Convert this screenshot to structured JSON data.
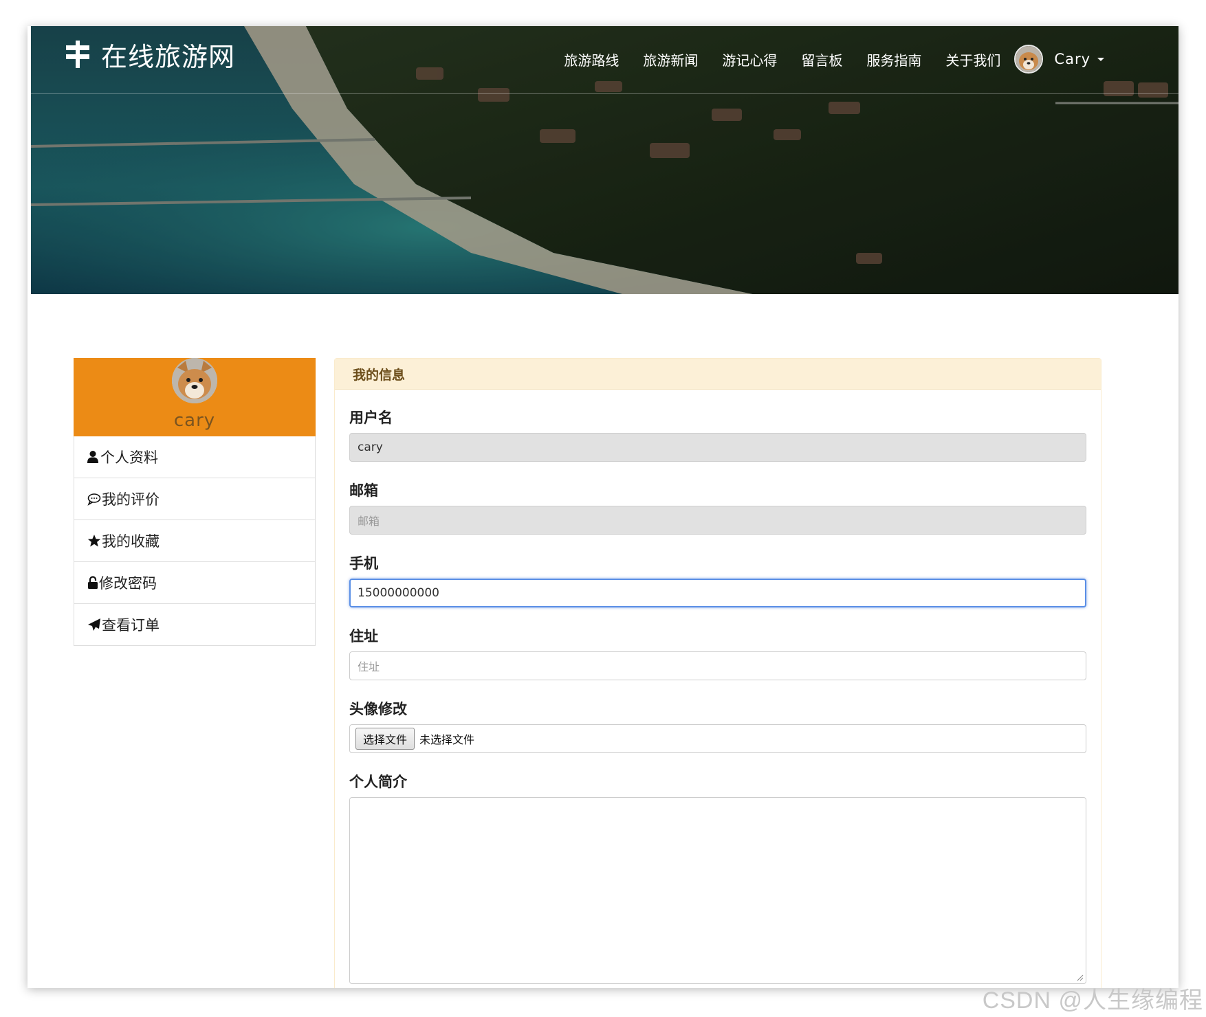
{
  "brand": {
    "title": "在线旅游网"
  },
  "nav": {
    "items": [
      "旅游路线",
      "旅游新闻",
      "游记心得",
      "留言板",
      "服务指南",
      "关于我们"
    ],
    "user_name": "Cary"
  },
  "sidebar": {
    "profile_name": "cary",
    "items": [
      {
        "label": "个人资料",
        "icon": "user-icon"
      },
      {
        "label": "我的评价",
        "icon": "comment-icon"
      },
      {
        "label": "我的收藏",
        "icon": "star-icon"
      },
      {
        "label": "修改密码",
        "icon": "lock-icon"
      },
      {
        "label": "查看订单",
        "icon": "send-icon"
      }
    ]
  },
  "panel": {
    "heading": "我的信息",
    "fields": {
      "username": {
        "label": "用户名",
        "value": "cary"
      },
      "email": {
        "label": "邮箱",
        "placeholder": "邮箱"
      },
      "phone": {
        "label": "手机",
        "value": "15000000000"
      },
      "address": {
        "label": "住址",
        "placeholder": "住址"
      },
      "avatar": {
        "label": "头像修改",
        "button": "选择文件",
        "status": "未选择文件"
      },
      "bio": {
        "label": "个人简介",
        "value": ""
      }
    }
  },
  "colors": {
    "profile_bg": "#ec8b15",
    "panel_heading_bg": "#fcf0d7",
    "focus_border": "#5a8fe6",
    "submit": "#3c9b3c"
  },
  "watermark": "CSDN @人生缘编程"
}
